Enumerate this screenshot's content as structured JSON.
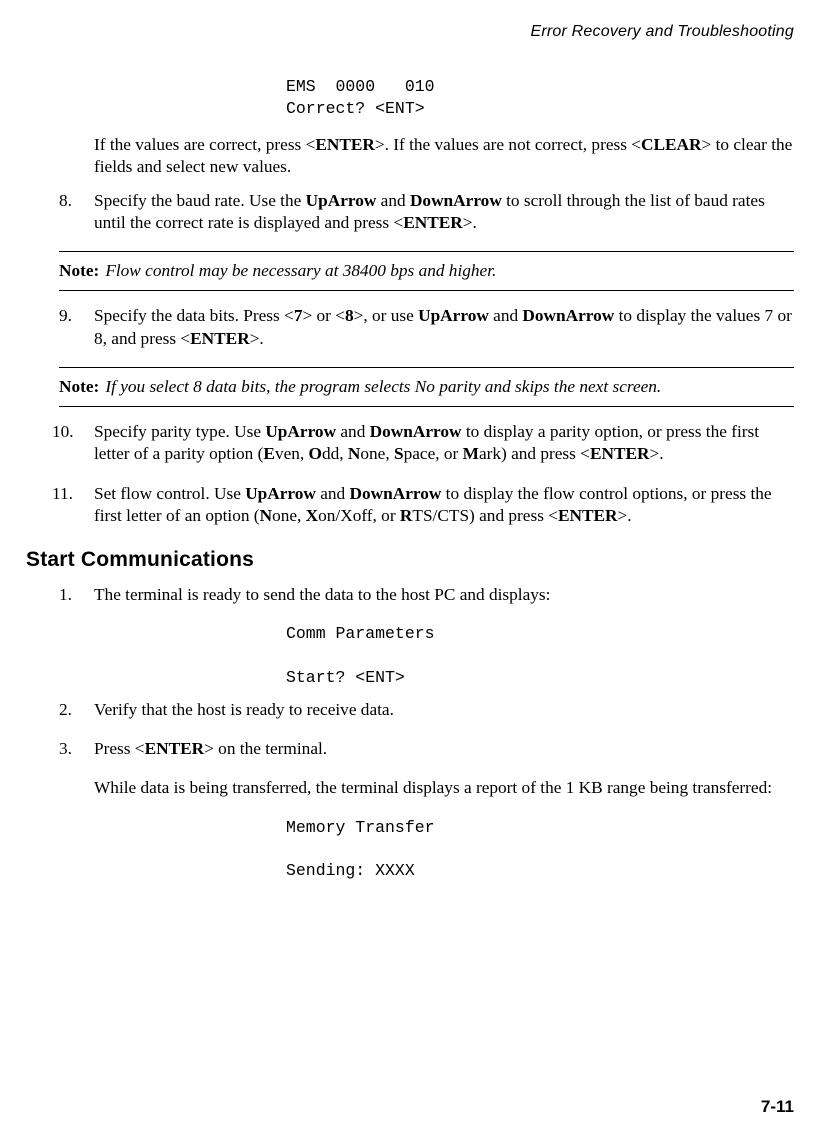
{
  "header": {
    "running_title": "Error Recovery and Troubleshooting"
  },
  "code_blocks": {
    "ems": "EMS  0000   010\nCorrect? <ENT>",
    "comm": "Comm Parameters\n\nStart? <ENT>",
    "mem": "Memory Transfer\n\nSending: XXXX"
  },
  "intro_after_code": {
    "pre1": "If the values are correct, press <",
    "b1": "ENTER",
    "mid1": ">. If the values are not correct, press <",
    "b2": "CLEAR",
    "post1": "> to clear the fields and select new values."
  },
  "steps": {
    "s8": {
      "num": "8.",
      "t1": "Specify the baud rate. Use the ",
      "b1": "UpArrow",
      "t2": " and ",
      "b2": "DownArrow",
      "t3": " to scroll through the list of baud rates until the correct rate is displayed and press <",
      "b3": "ENTER",
      "t4": ">."
    },
    "note1": {
      "label": "Note:",
      "text": "Flow control may be necessary at 38400 bps and higher."
    },
    "s9": {
      "num": "9.",
      "t1": "Specify the data bits. Press <",
      "b1": "7",
      "t2": "> or <",
      "b2": "8",
      "t3": ">, or use ",
      "b3": "UpArrow",
      "t4": " and ",
      "b4": "DownArrow",
      "t5": " to display the values 7 or 8, and press <",
      "b5": "ENTER",
      "t6": ">."
    },
    "note2": {
      "label": "Note:",
      "text": "If you select 8 data bits, the program selects No parity and skips the next screen."
    },
    "s10": {
      "num": "10.",
      "t1": "Specify parity type. Use ",
      "b1": "UpArrow",
      "t2": " and ",
      "b2": "DownArrow",
      "t3": " to display a parity option, or press the first letter of a parity option (",
      "b3": "E",
      "t4": "ven, ",
      "b4": "O",
      "t5": "dd, ",
      "b5": "N",
      "t6": "one, ",
      "b6": "S",
      "t7": "pace, or ",
      "b7": "M",
      "t8": "ark) and press <",
      "b8": "ENTER",
      "t9": ">."
    },
    "s11": {
      "num": "11.",
      "t1": "Set flow control. Use ",
      "b1": "UpArrow",
      "t2": " and ",
      "b2": "DownArrow",
      "t3": " to display the flow control options, or press the first letter of an option (",
      "b3": "N",
      "t4": "one, ",
      "b4": "X",
      "t5": "on/Xoff, or ",
      "b5": "R",
      "t6": "TS/CTS) and press <",
      "b6": "ENTER",
      "t7": ">."
    }
  },
  "section2": {
    "heading": "Start Communications",
    "s1": {
      "num": "1.",
      "t1": "The terminal is ready to send the data to the host PC and displays:"
    },
    "s2": {
      "num": "2.",
      "t1": "Verify that the host is ready to receive data."
    },
    "s3": {
      "num": "3.",
      "t1": "Press <",
      "b1": "ENTER",
      "t2": "> on the terminal.",
      "sub": "While data is being transferred, the terminal displays a report of the 1 KB range being transferred:"
    }
  },
  "footer": {
    "page_number": "7-11"
  }
}
